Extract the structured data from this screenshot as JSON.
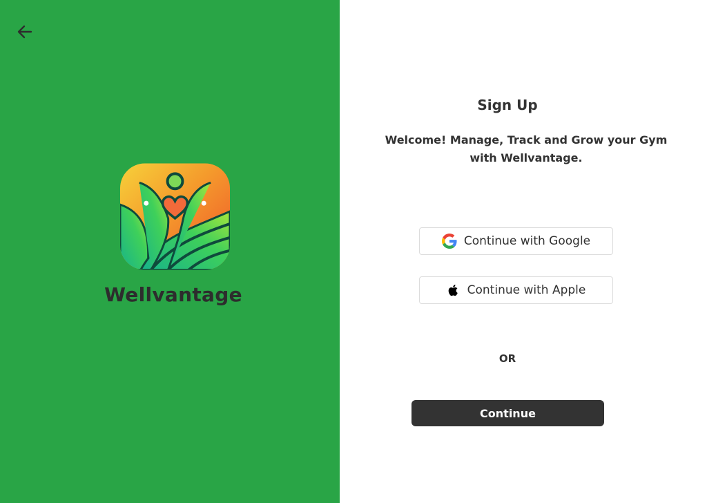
{
  "brand": {
    "name": "Wellvantage",
    "accent_color": "#29a546"
  },
  "nav": {
    "back_icon": "arrow-left-icon"
  },
  "signup": {
    "title": "Sign Up",
    "welcome_line1": "Welcome! Manage, Track and Grow your Gym",
    "welcome_line2": "with Wellvantage.",
    "google_label": "Continue with Google",
    "google_icon": "google-icon",
    "apple_label": "Continue with Apple",
    "apple_icon": "apple-icon",
    "or_label": "OR",
    "continue_label": "Continue"
  }
}
